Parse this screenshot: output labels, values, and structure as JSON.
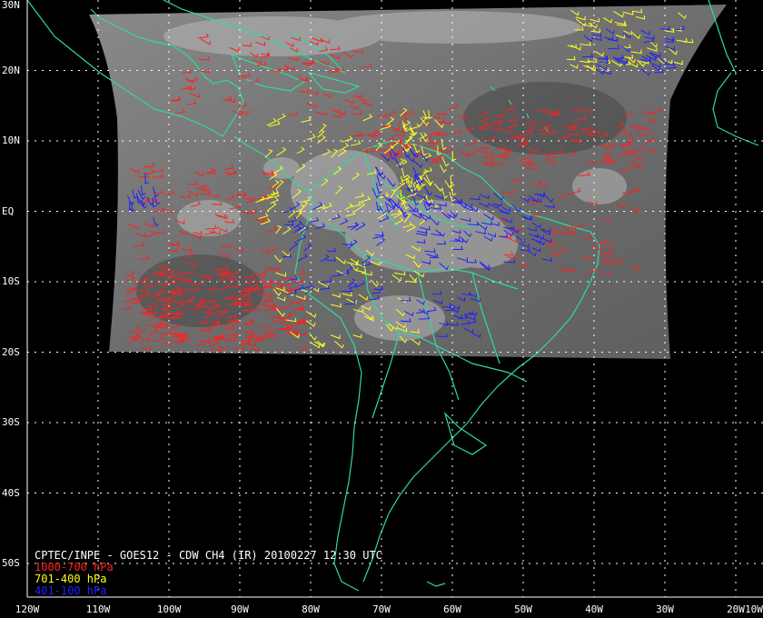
{
  "map": {
    "title": "CPTEC/INPE - GOES12 - CDW CH4 (IR) 20100227 12:30 UTC",
    "background_color": "#000000",
    "grid_color": "#ffffff",
    "coastline_color": "#2fd9a0",
    "satellite_area": {
      "lon_range": [
        -105,
        -25
      ],
      "lat_range": [
        -20,
        30
      ]
    },
    "lat_labels": [
      "30N",
      "20N",
      "10N",
      "EQ",
      "10S",
      "20S",
      "30S",
      "40S",
      "50S"
    ],
    "lat_values": [
      30,
      20,
      10,
      0,
      -10,
      -20,
      -30,
      -40,
      -50
    ],
    "lon_labels": [
      "120W",
      "110W",
      "100W",
      "90W",
      "80W",
      "70W",
      "60W",
      "50W",
      "40W",
      "30W",
      "20W",
      "10W"
    ],
    "lon_values": [
      -120,
      -110,
      -100,
      -90,
      -80,
      -70,
      -60,
      -50,
      -40,
      -30,
      -20,
      -10
    ]
  },
  "legend": [
    {
      "label": "1000-700 hPa",
      "color": "#ff2020"
    },
    {
      "label": "701-400 hPa",
      "color": "#ffff20"
    },
    {
      "label": "401-100 hPa",
      "color": "#2020ff"
    }
  ]
}
